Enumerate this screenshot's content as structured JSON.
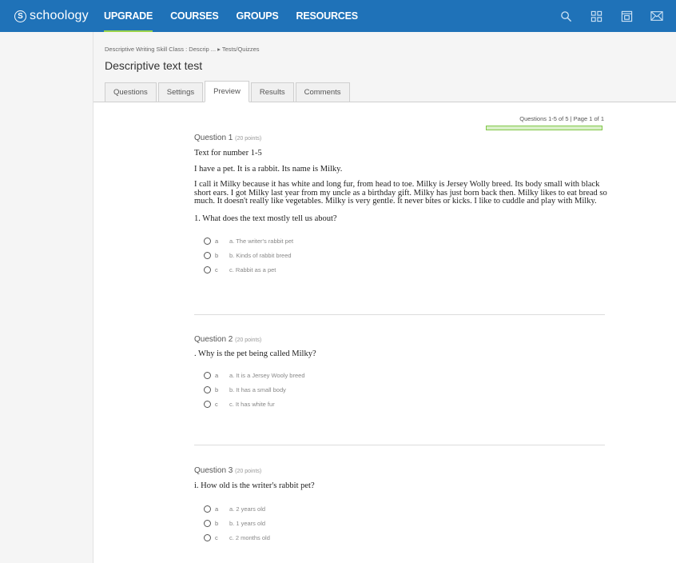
{
  "topbar": {
    "logo_text": "schoology",
    "nav": [
      "UPGRADE",
      "COURSES",
      "GROUPS",
      "RESOURCES"
    ],
    "icons": [
      "search-icon",
      "apps-grid-icon",
      "calendar-icon",
      "mail-icon"
    ],
    "colors": {
      "bar": "#1f72b8",
      "active_underline": "#9bd44a"
    }
  },
  "header": {
    "breadcrumb": "Descriptive Writing Skill Class : Descrip ... ▸ Tests/Quizzes",
    "title": "Descriptive text test",
    "tabs": [
      "Questions",
      "Settings",
      "Preview",
      "Results",
      "Comments"
    ]
  },
  "pager": {
    "text": "Questions 1-5 of 5 | Page 1 of 1",
    "progress_percent": 100
  },
  "questions": [
    {
      "label": "Question 1",
      "points": "(20 points)",
      "intro": "Text for number 1-5",
      "line1": "I have a pet. It is a rabbit. Its name is Milky.",
      "passage": "I call it Milky because it has white and long fur, from head to toe. Milky is Jersey Wolly breed. Its body small with black short ears. I got Milky last year from my uncle as a birthday gift. Milky has just born back then. Milky likes to eat bread so much. It doesn't really like vegetables. Milky is very gentle. It never bites or kicks. I like to cuddle and play with Milky.",
      "prompt": "1.    What does the text mostly tell us about?",
      "options": [
        {
          "letter": "a",
          "text": "a. The writer's rabbit pet"
        },
        {
          "letter": "b",
          "text": "b. Kinds of rabbit breed"
        },
        {
          "letter": "c",
          "text": "c. Rabbit as a pet"
        }
      ]
    },
    {
      "label": "Question 2",
      "points": "(20 points)",
      "prompt": ". Why is the pet being called Milky?",
      "options": [
        {
          "letter": "a",
          "text": "a. It is a Jersey Wooly breed"
        },
        {
          "letter": "b",
          "text": "b. It has a small body"
        },
        {
          "letter": "c",
          "text": "c. It has white fur"
        }
      ]
    },
    {
      "label": "Question 3",
      "points": "(20 points)",
      "prompt": "i.    How old is the writer's rabbit pet?",
      "options": [
        {
          "letter": "a",
          "text": "a. 2 years old"
        },
        {
          "letter": "b",
          "text": "b. 1 years old"
        },
        {
          "letter": "c",
          "text": "c. 2 months old"
        }
      ]
    }
  ]
}
